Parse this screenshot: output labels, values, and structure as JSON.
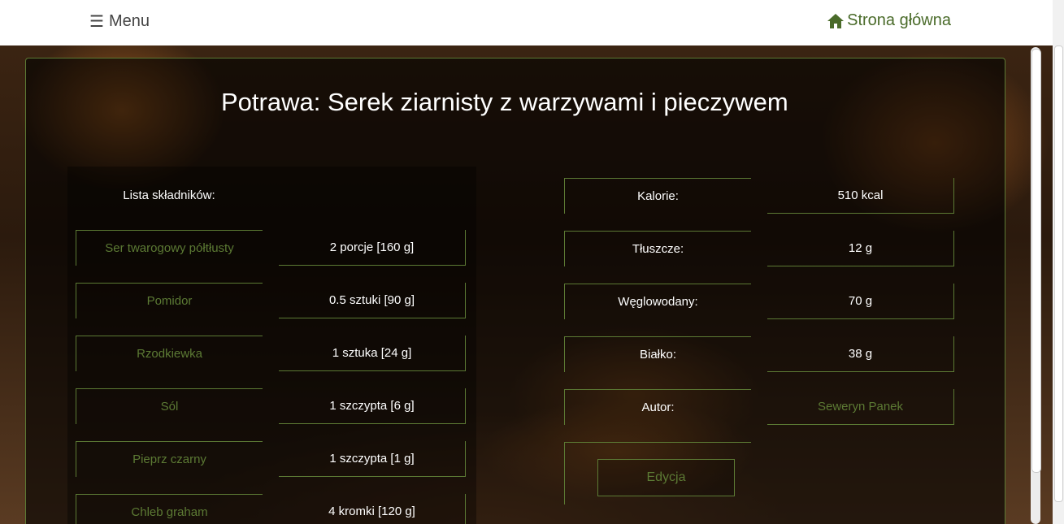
{
  "nav": {
    "menu_icon": "hamburger-icon",
    "menu_glyph": "☰",
    "menu_label": "Menu",
    "home_icon": "home-icon",
    "home_label": "Strona główna"
  },
  "page": {
    "title": "Potrawa: Serek ziarnisty z warzywami i pieczywem"
  },
  "ingredients": {
    "header": "Lista składników:",
    "items": [
      {
        "name": "Ser twarogowy półtłusty",
        "amount": "2 porcje [160 g]"
      },
      {
        "name": "Pomidor",
        "amount": "0.5 sztuki [90 g]"
      },
      {
        "name": "Rzodkiewka",
        "amount": "1 sztuka [24 g]"
      },
      {
        "name": "Sól",
        "amount": "1 szczypta [6 g]"
      },
      {
        "name": "Pieprz czarny",
        "amount": "1 szczypta [1 g]"
      },
      {
        "name": "Chleb graham",
        "amount": "4 kromki [120 g]"
      }
    ]
  },
  "nutrition": {
    "rows": [
      {
        "label": "Kalorie:",
        "value": "510 kcal"
      },
      {
        "label": "Tłuszcze:",
        "value": "12 g"
      },
      {
        "label": "Węglowodany:",
        "value": "70 g"
      },
      {
        "label": "Białko:",
        "value": "38 g"
      },
      {
        "label": "Autor:",
        "value": "Seweryn Panek"
      }
    ],
    "edit_label": "Edycja"
  },
  "colors": {
    "accent": "#5c7a34",
    "home_link": "#4a6b2a"
  }
}
